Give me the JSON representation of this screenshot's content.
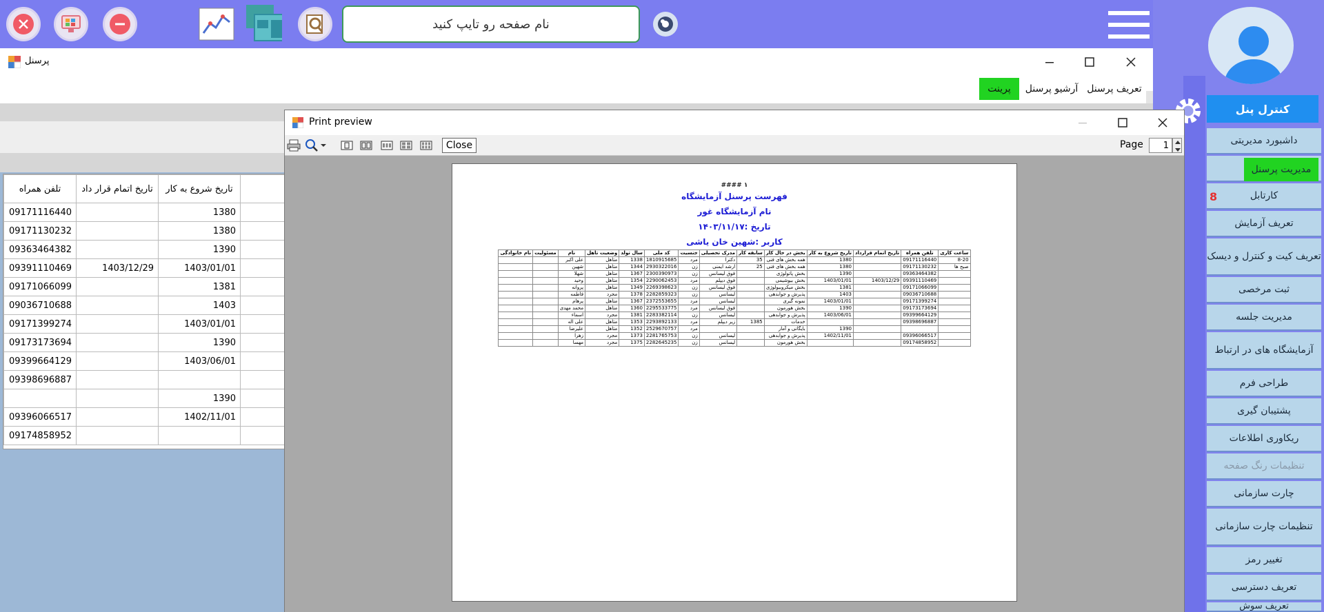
{
  "topbar": {
    "page_name_placeholder": "نام صفحه رو تایپ کنید",
    "accent_color": "#7b7df0"
  },
  "window": {
    "title": "پرسنل",
    "menu": [
      "تعریف پرسنل",
      "آرشیو پرسنل",
      "پرینت"
    ],
    "active_menu_color": "#21d321"
  },
  "grid": {
    "headers": [
      "تلفن همراه",
      "تاریخ اتمام قرار داد",
      "تاریخ شروع به کار"
    ],
    "rows": [
      [
        "09171116440",
        "",
        "1380"
      ],
      [
        "09171130232",
        "",
        "1380"
      ],
      [
        "09363464382",
        "",
        "1390"
      ],
      [
        "09391110469",
        "1403/12/29",
        "1403/01/01"
      ],
      [
        "09171066099",
        "",
        "1381"
      ],
      [
        "09036710688",
        "",
        "1403"
      ],
      [
        "09171399274",
        "",
        "1403/01/01"
      ],
      [
        "09173173694",
        "",
        "1390"
      ],
      [
        "09399664129",
        "",
        "1403/06/01"
      ],
      [
        "09398696887",
        "",
        ""
      ],
      [
        "",
        "",
        "1390"
      ],
      [
        "09396066517",
        "",
        "1402/11/01"
      ],
      [
        "09174858952",
        "",
        ""
      ]
    ]
  },
  "print_preview": {
    "title": "Print preview",
    "close_label": "Close",
    "page_label": "Page",
    "page_value": "1",
    "report": {
      "line1": "۱ ####",
      "title": "فهرست پرسنل آزمایشگاه",
      "lab": "نام آزمایشگاه غور",
      "date": "تاریخ :۱۴۰۳/۱۱/۱۷",
      "user": "کاربر :شهین خان یاشی"
    },
    "table_headers": [
      "ساعت کاری",
      "تلفن همراه",
      "تاریخ اتمام قرارداد",
      "تاریخ شروع به کار",
      "بخش در حال کار",
      "سابقه کار",
      "مدرک تحصیلی",
      "جنسیت",
      "کد ملی",
      "سال تولد",
      "وضعیت تاهل",
      "نام",
      "مسئولیت",
      "نام خانوادگی"
    ],
    "table_rows": [
      [
        "8-20",
        "09171116440",
        "",
        "1380",
        "همه بخش های فنی",
        "35",
        "دکترا",
        "مرد",
        "1810915685",
        "1338",
        "متاهل",
        "علی اکبر",
        "",
        ""
      ],
      [
        "صبح ها",
        "09171130232",
        "",
        "1380",
        "همه بخش های فنی",
        "25",
        "ارشد ایمنی",
        "زن",
        "2930322016",
        "1344",
        "متاهل",
        "شهین",
        "",
        ""
      ],
      [
        "",
        "09363464382",
        "",
        "1390",
        "بخش پاتولوژی",
        "",
        "فوق لیسانس",
        "زن",
        "2300390973",
        "1367",
        "متاهل",
        "شهلا",
        "",
        ""
      ],
      [
        "",
        "09391110469",
        "1403/12/29",
        "1403/01/01",
        "بخش بیوشیمی",
        "",
        "فوق دیپلم",
        "مرد",
        "2290062453",
        "1354",
        "متاهل",
        "وحید",
        "",
        ""
      ],
      [
        "",
        "09171066099",
        "",
        "1381",
        "بخش میکروبیولوژی",
        "",
        "فوق لیسانس",
        "زن",
        "2269398623",
        "1349",
        "متاهل",
        "پروانه",
        "",
        ""
      ],
      [
        "",
        "09036710688",
        "",
        "1403",
        "پذیرش و جوابدهی",
        "",
        "لیسانس",
        "زن",
        "2282859323",
        "1378",
        "مجرد",
        "فاطمه",
        "",
        ""
      ],
      [
        "",
        "09171399274",
        "",
        "1403/01/01",
        "نمونه گیری",
        "",
        "لیسانس",
        "مرد",
        "2372553655",
        "1367",
        "متاهل",
        "پرهام",
        "",
        ""
      ],
      [
        "",
        "09173173694",
        "",
        "1390",
        "بخش هورمون",
        "",
        "فوق لیسانس",
        "مرد",
        "2295533775",
        "1360",
        "متاهل",
        "محمد مهدی",
        "",
        ""
      ],
      [
        "",
        "09399664129",
        "",
        "1403/06/01",
        "پذیرش و جوابدهی",
        "",
        "لیسانس",
        "زن",
        "2283382114",
        "1381",
        "مجرد",
        "اسماء",
        "",
        ""
      ],
      [
        "",
        "09398696887",
        "",
        "",
        "خدمات",
        "1385",
        "زیر دیپلم",
        "مرد",
        "2293892133",
        "1353",
        "متاهل",
        "علی اله",
        "",
        ""
      ],
      [
        "",
        "",
        "",
        "1390",
        "بایگانی و آمار",
        "",
        "",
        "مرد",
        "2529670757",
        "1352",
        "متاهل",
        "علیرضا",
        "",
        ""
      ],
      [
        "",
        "09396066517",
        "",
        "1402/11/01",
        "پذیرش و جوابدهی",
        "",
        "لیسانس",
        "زن",
        "2281765753",
        "1373",
        "مجرد",
        "زهرا",
        "",
        ""
      ],
      [
        "",
        "09174858952",
        "",
        "",
        "بخش هورمون",
        "",
        "لیسانس",
        "زن",
        "2282645235",
        "1375",
        "مجرد",
        "مهسا",
        "",
        ""
      ]
    ]
  },
  "sidebar": {
    "header": "کنترل پنل",
    "badge_count": "8",
    "items": [
      "داشبورد مدیریتی",
      "مدیریت پرسنل",
      "کارتابل",
      "تعریف آزمایش",
      "تعریف کیت و کنترل و دیسک",
      "ثبت مرخصی",
      "مدیریت جلسه",
      "آزمایشگاه های در ارتباط",
      "طراحی فرم",
      "پشتیبان گیری",
      "ریکاوری اطلاعات",
      "تنظیمات رنگ صفحه",
      "چارت سازمانی",
      "تنظیمات چارت سازمانی",
      "تغییر رمز",
      "تعریف دسترسی",
      "تعریف سوش"
    ],
    "active_color": "#21d321",
    "header_color": "#1f8ff0"
  }
}
